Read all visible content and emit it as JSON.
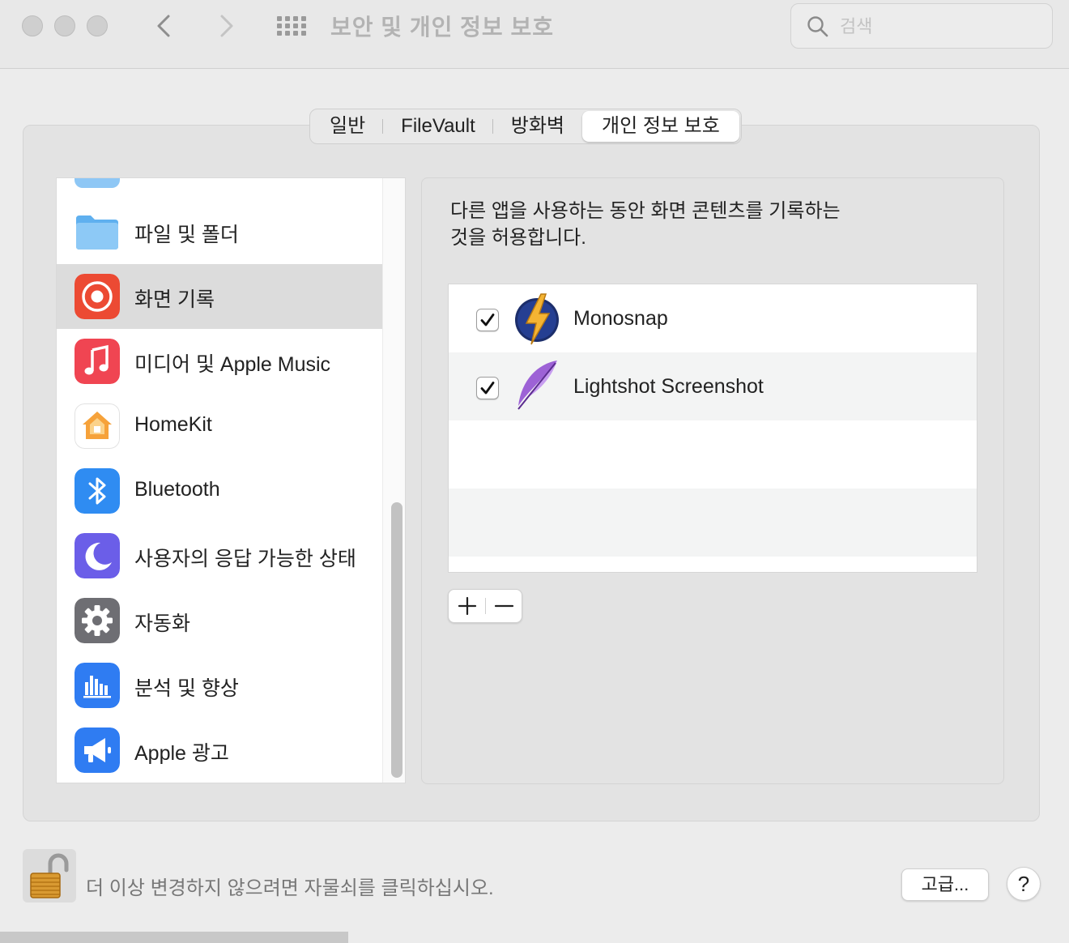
{
  "window": {
    "title": "보안 및 개인 정보 보호",
    "search_placeholder": "검색",
    "icons": [
      "back-chevron-icon",
      "forward-chevron-icon",
      "show-all-grid-icon",
      "search-icon"
    ]
  },
  "tabs": [
    {
      "label": "일반",
      "active": false
    },
    {
      "label": "FileVault",
      "active": false
    },
    {
      "label": "방화벽",
      "active": false
    },
    {
      "label": "개인 정보 보호",
      "active": true
    }
  ],
  "sidebar": {
    "items": [
      {
        "label": "파일 및 폴더",
        "icon": "folder-icon",
        "selected": false
      },
      {
        "label": "화면 기록",
        "icon": "screen-recording-icon",
        "selected": true
      },
      {
        "label": "미디어 및 Apple Music",
        "icon": "music-icon",
        "selected": false
      },
      {
        "label": "HomeKit",
        "icon": "homekit-icon",
        "selected": false
      },
      {
        "label": "Bluetooth",
        "icon": "bluetooth-icon",
        "selected": false
      },
      {
        "label": "사용자의 응답 가능한 상태",
        "icon": "moon-icon",
        "selected": false
      },
      {
        "label": "자동화",
        "icon": "gear-icon",
        "selected": false
      },
      {
        "label": "분석 및 향상",
        "icon": "analytics-icon",
        "selected": false
      },
      {
        "label": "Apple 광고",
        "icon": "megaphone-icon",
        "selected": false
      }
    ]
  },
  "panel": {
    "description_line1": "다른 앱을 사용하는 동안 화면 콘텐츠를 기록하는",
    "description_line2": "것을 허용합니다.",
    "apps": [
      {
        "name": "Monosnap",
        "checked": true,
        "icon": "monosnap-icon"
      },
      {
        "name": "Lightshot Screenshot",
        "checked": true,
        "icon": "lightshot-feather-icon"
      }
    ],
    "add_label": "+",
    "remove_label": "−"
  },
  "footer": {
    "lock_text": "더 이상 변경하지 않으려면 자물쇠를 클릭하십시오.",
    "advanced_label": "고급...",
    "help_label": "?"
  },
  "colors": {
    "selected_row": "#dcdcdc",
    "screen_record_icon": "#ec4a33",
    "music_icon": "#f04552",
    "bluetooth_icon": "#2f8cf2",
    "moon_icon": "#6b5ee8",
    "analytics_icon": "#2f7cf2"
  }
}
